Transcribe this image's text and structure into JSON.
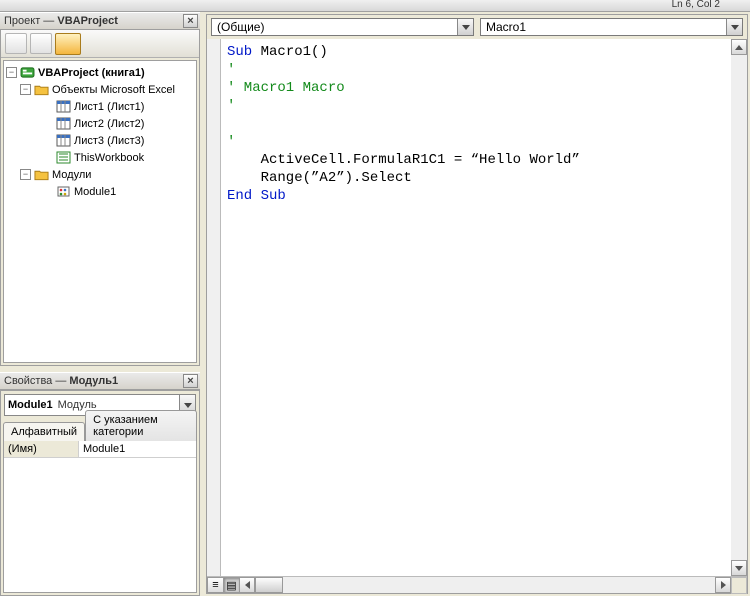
{
  "status": {
    "cursor": "Ln 6, Col 2"
  },
  "project_panel": {
    "title_prefix": "Проект — ",
    "title_bold": "VBAProject",
    "tree": {
      "root": "VBAProject (книга1)",
      "objects_folder": "Объекты Microsoft Excel",
      "sheets": [
        "Лист1 (Лист1)",
        "Лист2 (Лист2)",
        "Лист3 (Лист3)"
      ],
      "workbook": "ThisWorkbook",
      "modules_folder": "Модули",
      "module": "Module1"
    }
  },
  "properties_panel": {
    "title_prefix": "Свойства — ",
    "title_bold": "Модуль1",
    "combo_name": "Module1",
    "combo_type": "Модуль",
    "tab_alpha": "Алфавитный",
    "tab_cat": "С указанием категории",
    "prop_key": "(Имя)",
    "prop_val": "Module1"
  },
  "code": {
    "left_combo": "(Общие)",
    "right_combo": "Macro1",
    "l1a": "Sub",
    "l1b": " Macro1()",
    "l2": "'",
    "l3": "' Macro1 Macro",
    "l4": "'",
    "l5blank": "",
    "l6": "'",
    "l7": "    ActiveCell.FormulaR1C1 = “Hello World”",
    "l8": "    Range(”A2”).Select",
    "l9": "End Sub"
  }
}
